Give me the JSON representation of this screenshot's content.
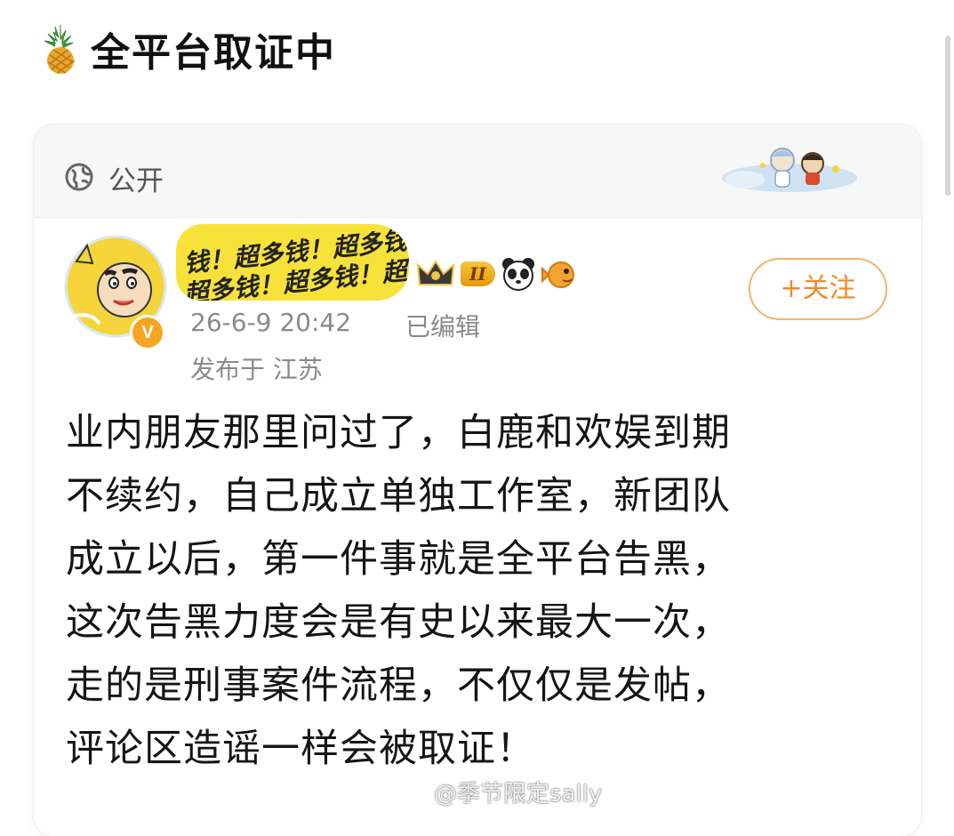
{
  "header": {
    "icon": "pineapple-icon",
    "title": "全平台取证中"
  },
  "post": {
    "visibility": {
      "icon": "globe-icon",
      "label": "公开"
    },
    "author": {
      "name_banner_line1": "钱！超多钱！超多钱",
      "name_banner_line2": "超多钱！超多钱！超",
      "level_badge": "II",
      "verified_mark": "V"
    },
    "follow_label": "+关注",
    "timestamp": "26-6-9 20:42",
    "edited_label": "已编辑",
    "location": "发布于 江苏",
    "body_lines": [
      "业内朋友那里问过了，白鹿和欢娱到期",
      "不续约，自己成立单独工作室，新团队",
      "成立以后，第一件事就是全平台告黑，",
      "这次告黑力度会是有史以来最大一次，",
      "走的是刑事案件流程，不仅仅是发帖，",
      "评论区造谣一样会被取证！"
    ]
  },
  "watermark": {
    "text": "@季节限定sally"
  },
  "colors": {
    "accent_orange": "#f08a2a",
    "follow_border": "#f1b46b",
    "banner_yellow": "#f7e23a",
    "verified_badge": "#f6a623",
    "meta_gray": "#8a8a8a"
  }
}
